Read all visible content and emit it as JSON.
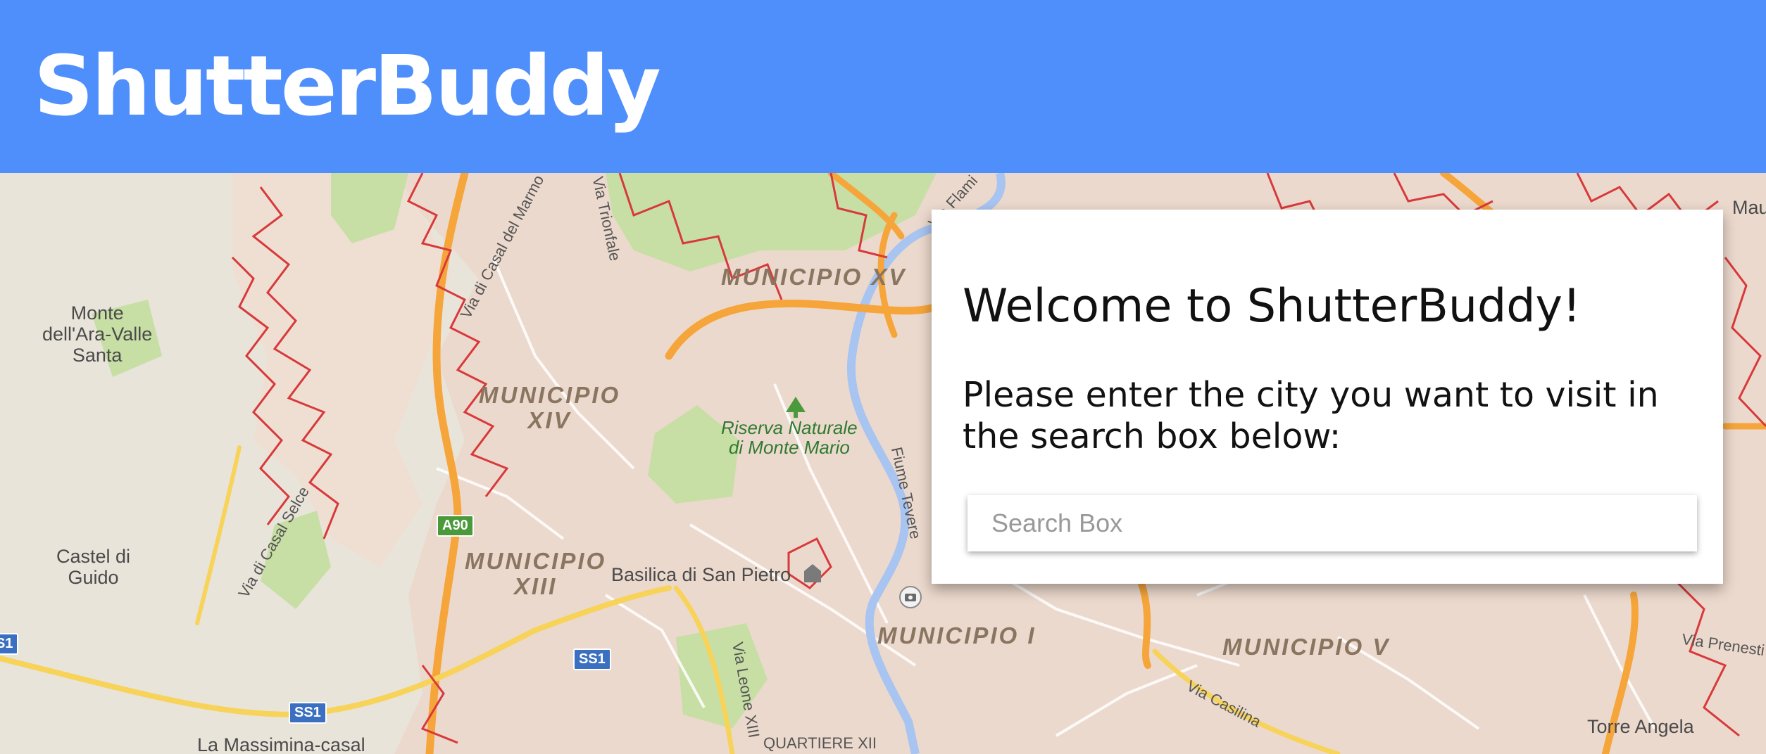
{
  "header": {
    "brand": "ShutterBuddy"
  },
  "welcome_card": {
    "title": "Welcome to ShutterBuddy!",
    "instructions": "Please enter the city you want to visit in the search box below:",
    "search": {
      "placeholder": "Search Box",
      "value": ""
    }
  },
  "map": {
    "labels": {
      "monte": "Monte\ndell'Ara-Valle\nSanta",
      "castel": "Castel di\nGuido",
      "massimina": "La Massimina-casal",
      "torre_angela": "Torre Angela",
      "mau": "Mau",
      "basilica": "Basilica di San Pietro",
      "riserva": "Riserva Naturale\ndi Monte Mario",
      "quartiere": "QUARTIERE XII"
    },
    "municipi": {
      "xv": "MUNICIPIO XV",
      "xiv": "MUNICIPIO\nXIV",
      "xiii": "MUNICIPIO\nXIII",
      "i": "MUNICIPIO I",
      "v": "MUNICIPIO V"
    },
    "roads": {
      "casal_marmo": "Via di Casal del Marmo",
      "trionfale": "Via Trionfale",
      "flaminia": "Via Flami",
      "fiume_tevere": "Fiume Tevere",
      "casal_selce": "Via di Casal Selce",
      "leone_xiii": "Via Leone XIII",
      "casilina": "Via Casilina",
      "prenestina": "Via Prenesti"
    },
    "shields": {
      "a90": "A90",
      "ss1_center": "SS1",
      "ss1_bottom": "SS1",
      "ss1_edge": "S1"
    },
    "colors": {
      "urban": "#ecd9cd",
      "rural": "#e9e4da",
      "park": "#c7dfa5",
      "highway": "#f6a53a",
      "boundary": "#d8393a",
      "river": "#a8c4f0"
    }
  }
}
